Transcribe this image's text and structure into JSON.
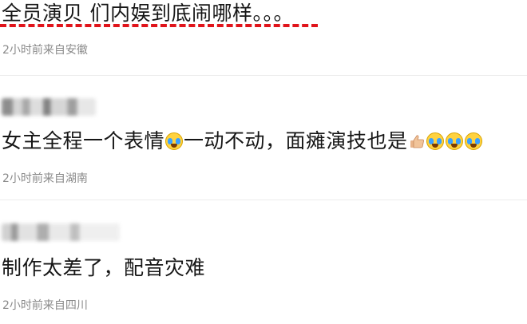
{
  "comments": [
    {
      "text_parts": [
        "全员演贝 们内娱到底闹哪样。。。"
      ],
      "meta": "2小时前来自安徽"
    },
    {
      "text_before": "女主全程一个表情",
      "text_middle": "一动不动，面瘫演技也是",
      "meta": "2小时前来自湖南"
    },
    {
      "text": "制作太差了，配音灾难",
      "meta": "2小时前来自四川"
    }
  ],
  "icons": {
    "crying_emoji": "laugh-cry-emoji-icon",
    "thumbs_up": "thumbs-up-icon"
  },
  "colors": {
    "highlight_underline": "#e0141b",
    "meta_text": "#8a8a8a"
  }
}
